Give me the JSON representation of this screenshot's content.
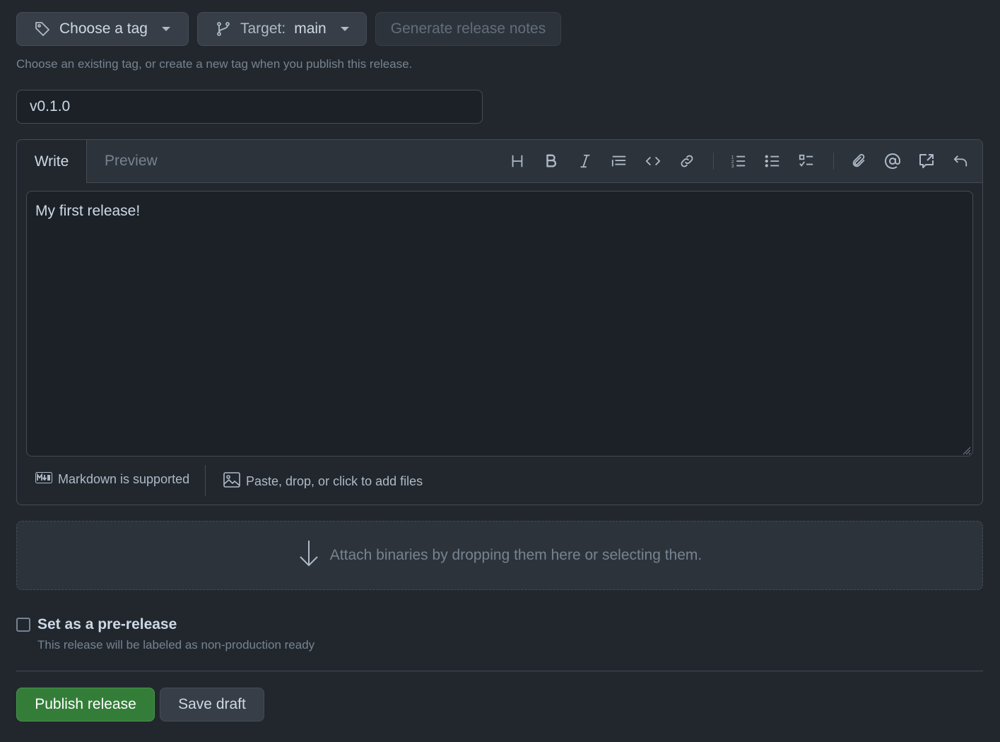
{
  "tag_picker": {
    "label": "Choose a tag",
    "icon": "tag-icon"
  },
  "target_picker": {
    "label": "Target:",
    "value": "main",
    "icon": "branch-icon"
  },
  "generate_notes": {
    "label": "Generate release notes"
  },
  "tag_hint": "Choose an existing tag, or create a new tag when you publish this release.",
  "release_title": {
    "value": "v0.1.0"
  },
  "editor": {
    "tabs": [
      "Write",
      "Preview"
    ],
    "active_tab": "Write",
    "toolbar": [
      "heading-icon",
      "bold-icon",
      "italic-icon",
      "quote-icon",
      "code-icon",
      "link-icon",
      "ordered-list-icon",
      "unordered-list-icon",
      "task-list-icon",
      "attach-icon",
      "mention-icon",
      "reference-icon",
      "undo-icon"
    ],
    "body": "My first release!",
    "markdown_note": "Markdown is supported",
    "files_note": "Paste, drop, or click to add files"
  },
  "dropzone": {
    "text": "Attach binaries by dropping them here or selecting them."
  },
  "prerelease": {
    "label": "Set as a pre-release",
    "description": "This release will be labeled as non-production ready",
    "checked": false
  },
  "actions": {
    "publish": "Publish release",
    "save_draft": "Save draft"
  },
  "colors": {
    "background": "#22272e",
    "primary": "#347d39",
    "border": "#444c56"
  }
}
